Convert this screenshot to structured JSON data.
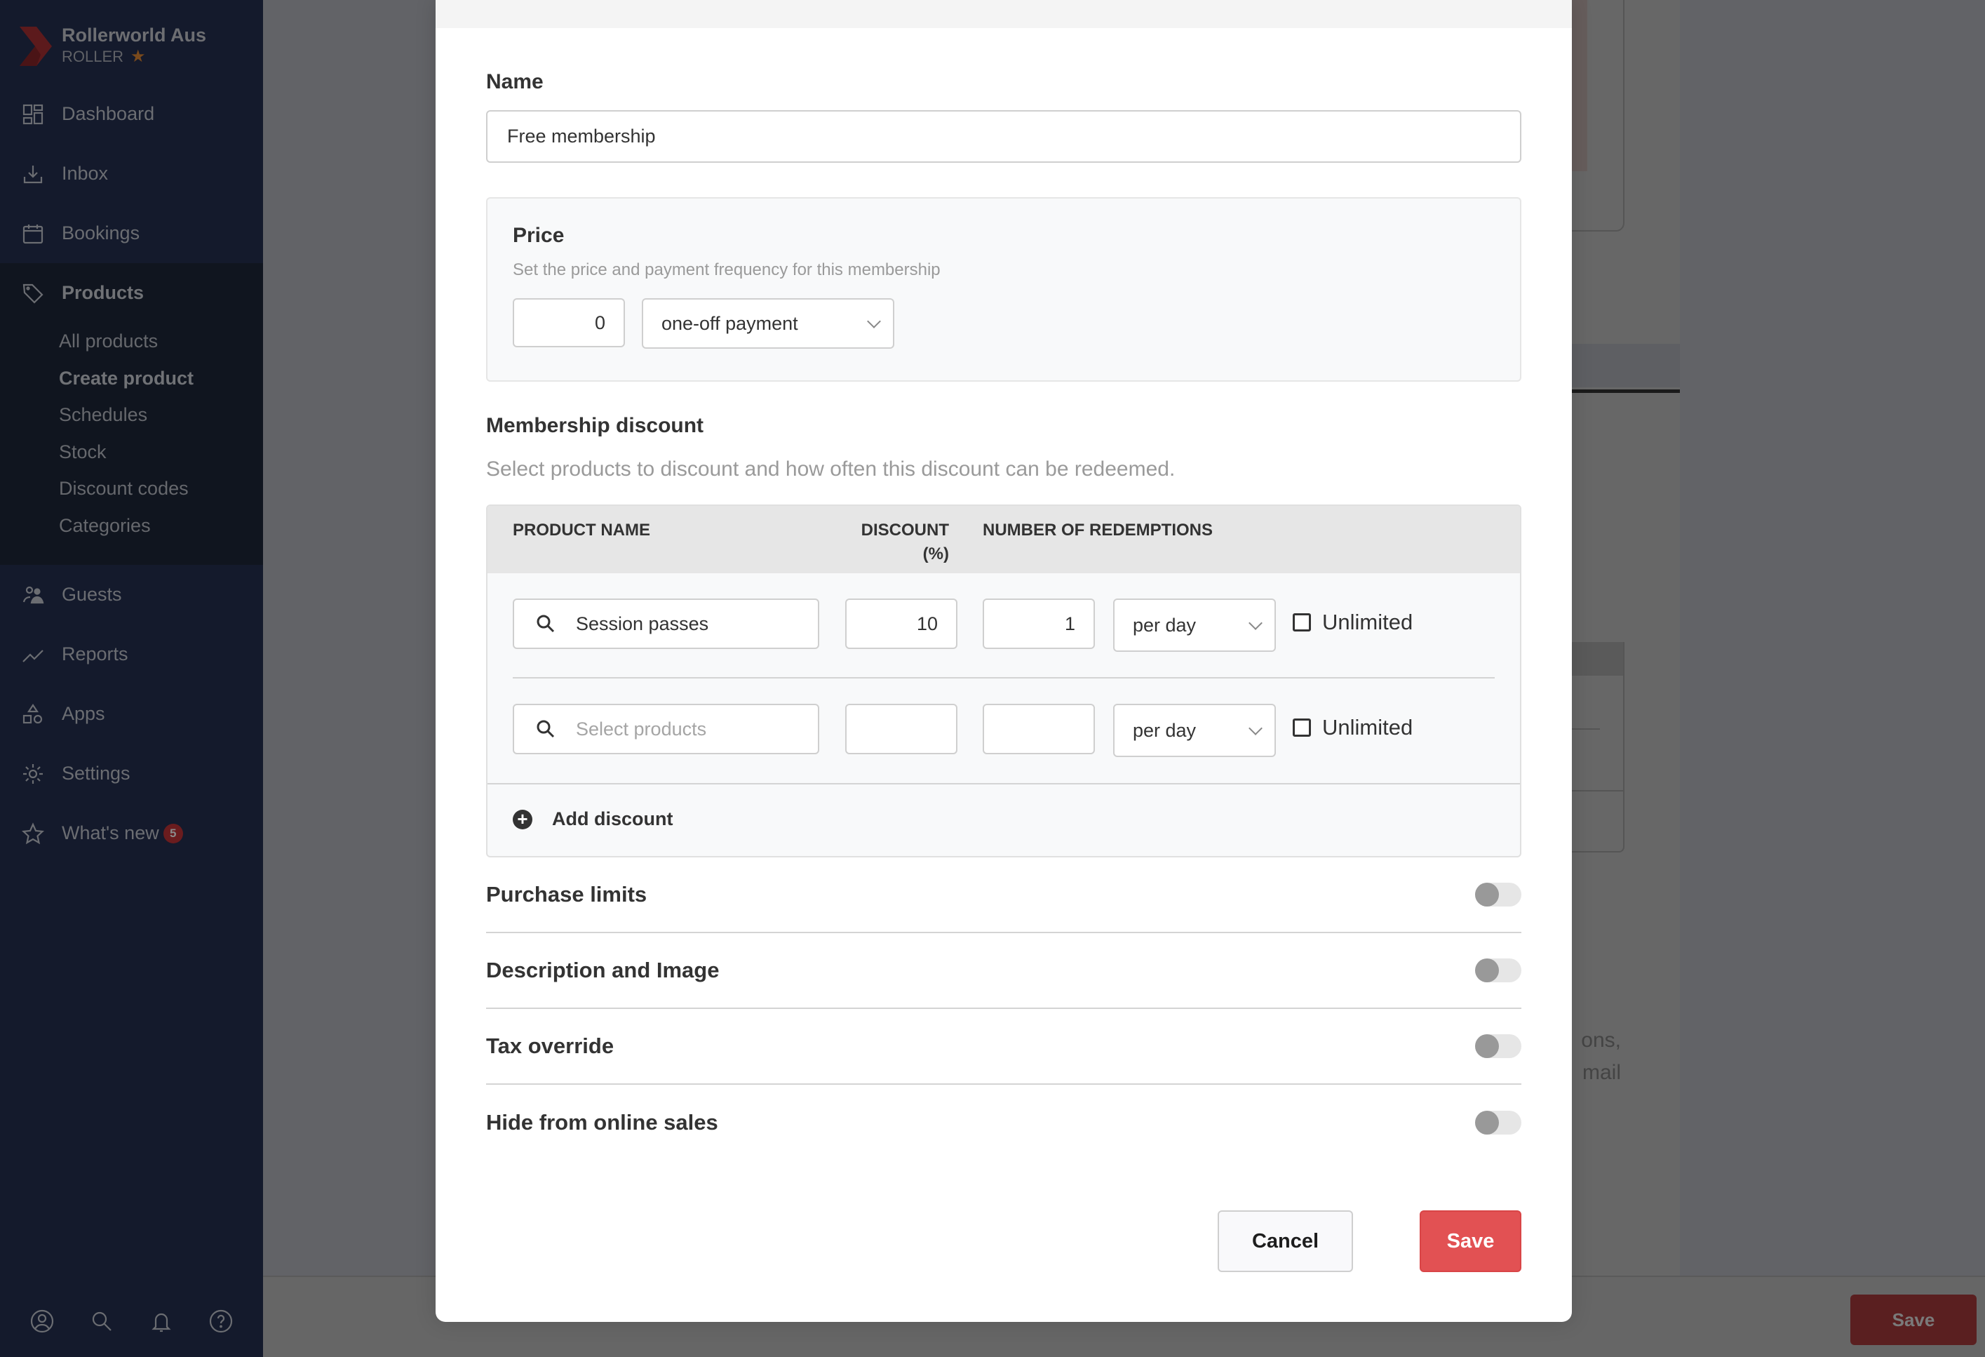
{
  "sidebar": {
    "brand": {
      "name": "Rollerworld Aus",
      "subtitle": "ROLLER"
    },
    "nav": [
      {
        "label": "Dashboard",
        "icon": "dashboard-icon"
      },
      {
        "label": "Inbox",
        "icon": "inbox-icon"
      },
      {
        "label": "Bookings",
        "icon": "calendar-icon"
      }
    ],
    "products": {
      "label": "Products",
      "icon": "tag-icon",
      "sub_items": [
        {
          "label": "All products",
          "active": false
        },
        {
          "label": "Create product",
          "active": true
        },
        {
          "label": "Schedules",
          "active": false
        },
        {
          "label": "Stock",
          "active": false
        },
        {
          "label": "Discount codes",
          "active": false
        },
        {
          "label": "Categories",
          "active": false
        }
      ]
    },
    "nav_lower": [
      {
        "label": "Guests",
        "icon": "guests-icon"
      },
      {
        "label": "Reports",
        "icon": "trend-icon"
      },
      {
        "label": "Apps",
        "icon": "apps-shapes-icon"
      },
      {
        "label": "Settings",
        "icon": "gear-icon"
      },
      {
        "label": "What's new",
        "icon": "star-icon",
        "badge": "5"
      }
    ],
    "footer_icons": [
      "account-icon",
      "search-icon",
      "bell-icon",
      "help-icon"
    ]
  },
  "background": {
    "partial_text": "ons,\nmail",
    "save_label": "Save"
  },
  "modal": {
    "name_label": "Name",
    "name_value": "Free membership",
    "price": {
      "title": "Price",
      "subtitle": "Set the price and payment frequency for this membership",
      "amount": "0",
      "frequency": "one-off payment"
    },
    "membership_discount": {
      "title": "Membership discount",
      "subtitle": "Select products to discount and how often this discount can be redeemed.",
      "columns": {
        "product_name": "PRODUCT NAME",
        "discount_line1": "DISCOUNT",
        "discount_line2": "(%)",
        "redemptions": "NUMBER OF REDEMPTIONS"
      },
      "rows": [
        {
          "product": "Session passes",
          "product_placeholder": "Select products",
          "discount": "10",
          "redemptions": "1",
          "period": "per day",
          "unlimited_label": "Unlimited",
          "unlimited": false
        },
        {
          "product": "",
          "product_placeholder": "Select products",
          "discount": "",
          "redemptions": "",
          "period": "per day",
          "unlimited_label": "Unlimited",
          "unlimited": false
        }
      ],
      "add_label": "Add discount"
    },
    "toggles": [
      {
        "label": "Purchase limits",
        "on": false
      },
      {
        "label": "Description and Image",
        "on": false
      },
      {
        "label": "Tax override",
        "on": false
      },
      {
        "label": "Hide from online sales",
        "on": false
      }
    ],
    "cancel_label": "Cancel",
    "save_label": "Save"
  },
  "colors": {
    "accent_red": "#e25153",
    "sidebar_bg": "#141a2c",
    "overlay": "#626367"
  }
}
